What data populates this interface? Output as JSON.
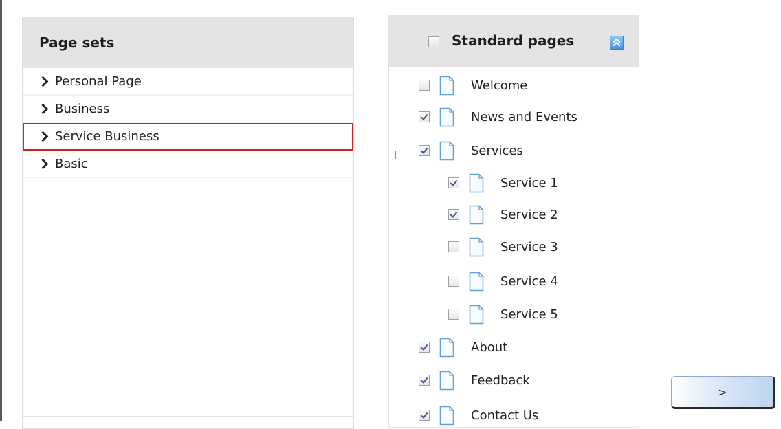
{
  "page_sets": {
    "title": "Page sets",
    "items": [
      {
        "label": "Personal Page",
        "selected": false
      },
      {
        "label": "Business",
        "selected": false
      },
      {
        "label": "Service Business",
        "selected": true
      },
      {
        "label": "Basic",
        "selected": false
      }
    ]
  },
  "standard_pages": {
    "title": "Standard pages",
    "header_checked": false,
    "collapse_icon": "double-chevron-up-icon",
    "pages": [
      {
        "label": "Welcome",
        "checked": false,
        "level": 0
      },
      {
        "label": "News and Events",
        "checked": true,
        "level": 0
      },
      {
        "label": "Services",
        "checked": true,
        "level": 0,
        "expanded": true
      },
      {
        "label": "Service 1",
        "checked": true,
        "level": 1
      },
      {
        "label": "Service 2",
        "checked": true,
        "level": 1
      },
      {
        "label": "Service 3",
        "checked": false,
        "level": 1
      },
      {
        "label": "Service 4",
        "checked": false,
        "level": 1
      },
      {
        "label": "Service 5",
        "checked": false,
        "level": 1
      },
      {
        "label": "About",
        "checked": true,
        "level": 0
      },
      {
        "label": "Feedback",
        "checked": true,
        "level": 0
      },
      {
        "label": "Contact Us",
        "checked": true,
        "level": 0
      }
    ]
  },
  "navigation": {
    "next_label": ">"
  },
  "colors": {
    "header_bg": "#e4e4e4",
    "selection_border": "#cc2222",
    "next_button_gradient_end": "#bcd5f0",
    "collapse_button": "#4e95e0"
  }
}
